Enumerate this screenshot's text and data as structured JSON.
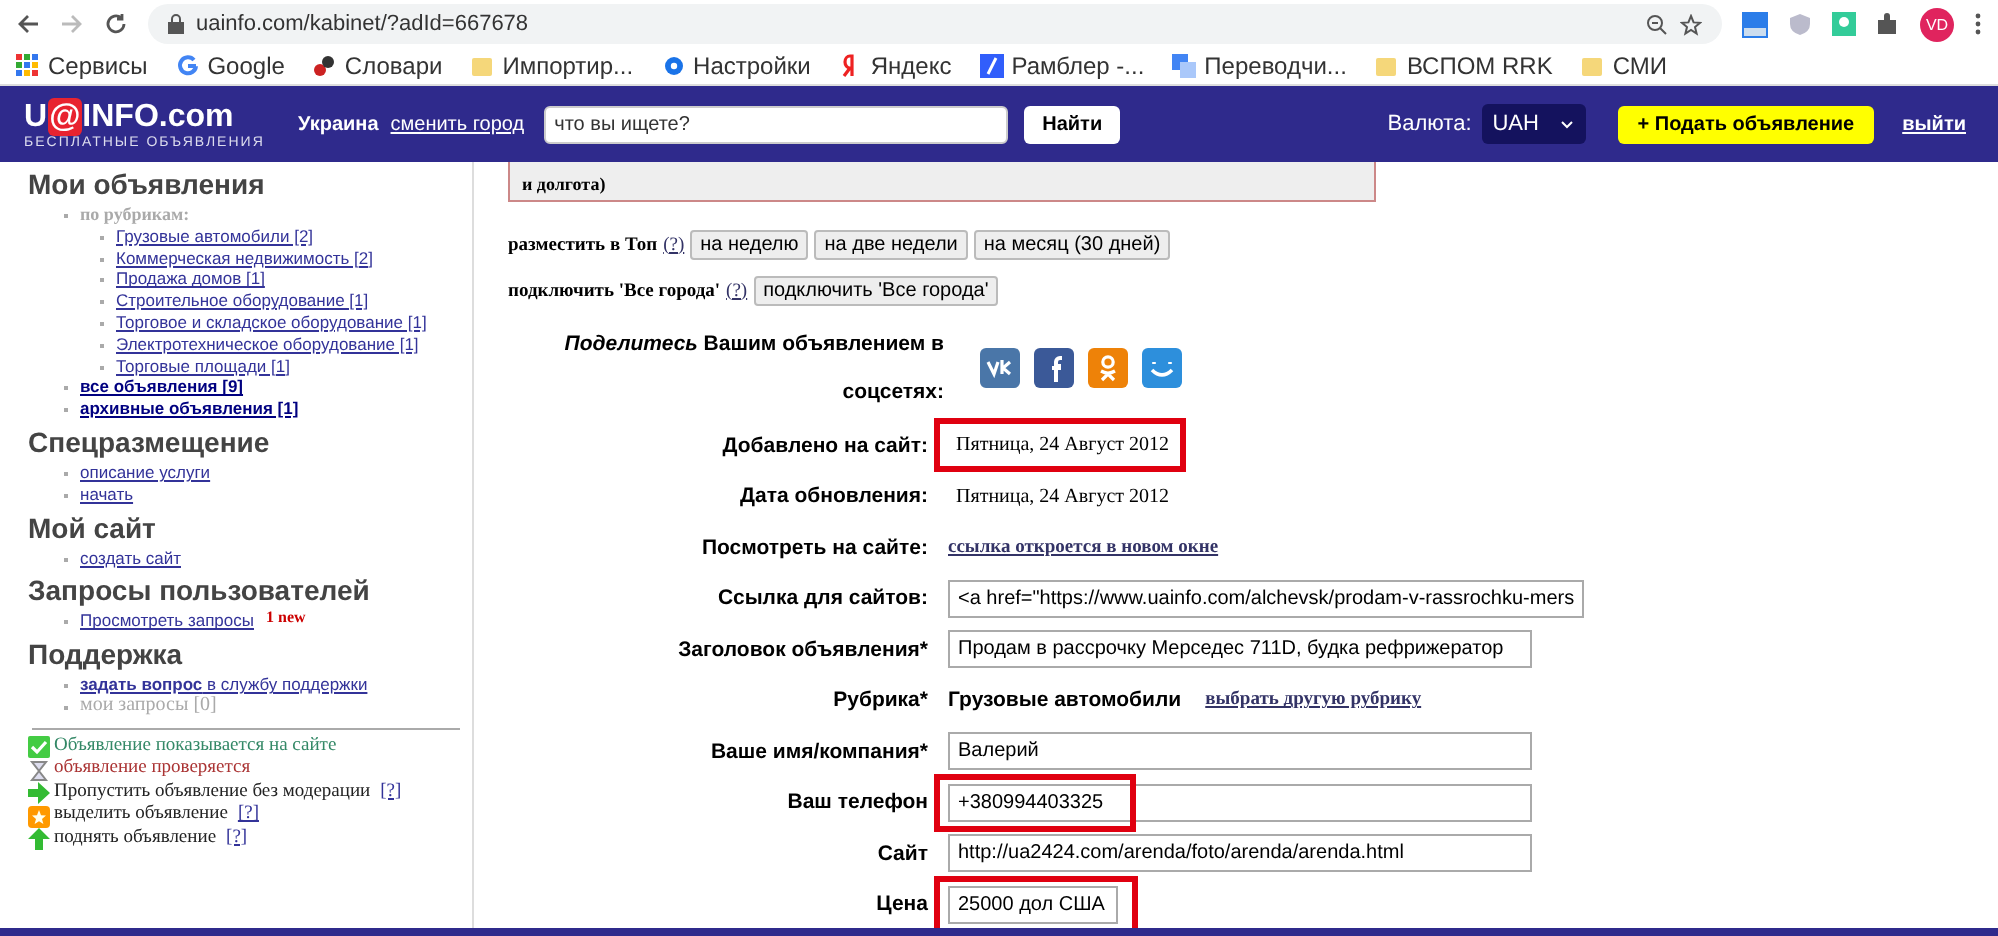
{
  "browser": {
    "url": "uainfo.com/kabinet/?adId=667678",
    "avatar": "VD",
    "bookmarks": [
      {
        "label": "Сервисы",
        "kind": "apps"
      },
      {
        "label": "Google",
        "kind": "google"
      },
      {
        "label": "Словари",
        "kind": "dict"
      },
      {
        "label": "Импортир...",
        "kind": "folder"
      },
      {
        "label": "Настройки",
        "kind": "gear"
      },
      {
        "label": "Яндекс",
        "kind": "yandex"
      },
      {
        "label": "Рамблер -...",
        "kind": "rambler"
      },
      {
        "label": "Переводчи...",
        "kind": "translate"
      },
      {
        "label": "ВСПОМ RRK",
        "kind": "folder"
      },
      {
        "label": "СМИ",
        "kind": "folder"
      }
    ]
  },
  "header": {
    "logo": [
      {
        "text": "U",
        "kind": "plain"
      },
      {
        "text": "@",
        "kind": "accent"
      },
      {
        "text": "INFO.com",
        "kind": "plain"
      }
    ],
    "tagline": "БЕСПЛАТНЫЕ ОБЪЯВЛЕНИЯ",
    "region": "Украина",
    "change_city": "сменить город",
    "search": {
      "placeholder": "что вы ищете?"
    },
    "search_button": "Найти",
    "currency_label": "Валюта:",
    "currency": "UAH",
    "add_button": "+ Подать объявление",
    "logout": "выйти"
  },
  "sidebar": {
    "sections": [
      {
        "title": "Мои объявления",
        "items": [
          {
            "kind": "muted",
            "text": "по рубрикам:",
            "children": [
              {
                "kind": "link",
                "text": "Грузовые автомобили [2]"
              },
              {
                "kind": "link",
                "text": "Коммерческая недвижимость [2]"
              },
              {
                "kind": "link",
                "text": "Продажа домов [1]"
              },
              {
                "kind": "link",
                "text": "Строительное оборудование [1]"
              },
              {
                "kind": "link",
                "text": "Торговое и складское оборудование [1]"
              },
              {
                "kind": "link",
                "text": "Электротехническое оборудование [1]"
              },
              {
                "kind": "link",
                "text": "Торговые площади [1]"
              }
            ]
          },
          {
            "kind": "bold-link",
            "text": "все объявления [9]"
          },
          {
            "kind": "bold-link",
            "text": "архивные объявления [1]"
          }
        ]
      },
      {
        "title": "Спецразмещение",
        "items": [
          {
            "kind": "link",
            "text": "описание услуги"
          },
          {
            "kind": "link",
            "text": "начать"
          }
        ]
      },
      {
        "title": "Мой сайт",
        "items": [
          {
            "kind": "link",
            "text": "создать сайт"
          }
        ]
      },
      {
        "title": "Запросы пользователей",
        "items": [
          {
            "kind": "link",
            "text": "Просмотреть запросы",
            "badge": "1 new"
          }
        ]
      },
      {
        "title": "Поддержка",
        "items": [
          {
            "kind": "link",
            "text": "**задать вопрос** в службу поддержки"
          },
          {
            "kind": "muted",
            "text": "мои запросы [0]"
          }
        ]
      }
    ],
    "legend": [
      {
        "kind": "check",
        "text": "Объявление показывается на сайте"
      },
      {
        "kind": "hourglass",
        "text": "объявление проверяется"
      },
      {
        "kind": "arrow-right",
        "text": "Пропустить объявление без модерации",
        "help": "[?]"
      },
      {
        "kind": "star",
        "text": "выделить объявление",
        "help": "[?]"
      },
      {
        "kind": "arrow-up",
        "text": "поднять объявление",
        "help": "[?]"
      }
    ]
  },
  "main": {
    "notice": "и долгота)",
    "top": {
      "label": "разместить в Топ",
      "help": "(?)",
      "buttons": [
        "на неделю",
        "на две недели",
        "на месяц (30 дней)"
      ]
    },
    "cities": {
      "label": "подключить 'Все города'",
      "help": "(?)",
      "buttons": [
        "подключить 'Все города'"
      ]
    },
    "share": {
      "label": "*Поделитесь* Вашим объявлением в соцсетях:",
      "networks": [
        {
          "kind": "vk",
          "color": "#4a76a8"
        },
        {
          "kind": "facebook",
          "color": "#3b5998"
        },
        {
          "kind": "ok",
          "color": "#ee8208"
        },
        {
          "kind": "smile",
          "color": "#2d8fdc"
        }
      ]
    },
    "fields": [
      {
        "label": "Добавлено на сайт:",
        "kind": "date",
        "value": "Пятница, 24 Август 2012",
        "highlighted": true
      },
      {
        "label": "Дата обновления:",
        "kind": "date",
        "value": "Пятница, 24 Август 2012",
        "highlighted": false
      },
      {
        "label": "Посмотреть на сайте:",
        "kind": "link",
        "value": "ссылка откроется в новом окне",
        "highlighted": false
      },
      {
        "label": "Ссылка для сайтов:",
        "kind": "input",
        "value": "<a href=\"https://www.uainfo.com/alchevsk/prodam-v-rassrochku-mers",
        "highlighted": false
      },
      {
        "label": "Заголовок объявления*",
        "kind": "input",
        "value": "Продам в рассрочку Мерседес 711D, будка рефрижератор",
        "highlighted": false
      },
      {
        "label": "Рубрика*",
        "kind": "category",
        "value": "Грузовые автомобили",
        "link": "выбрать другую рубрику",
        "highlighted": false
      },
      {
        "label": "Ваше имя/компания*",
        "kind": "input",
        "value": "Валерий",
        "highlighted": false
      },
      {
        "label": "Ваш телефон",
        "kind": "input",
        "value": "+380994403325",
        "highlighted": true
      },
      {
        "label": "Сайт",
        "kind": "input",
        "value": "http://ua2424.com/arenda/foto/arenda/arenda.html",
        "highlighted": false
      },
      {
        "label": "Цена",
        "kind": "short-input",
        "value": "25000 дол США",
        "highlighted": true
      }
    ]
  }
}
